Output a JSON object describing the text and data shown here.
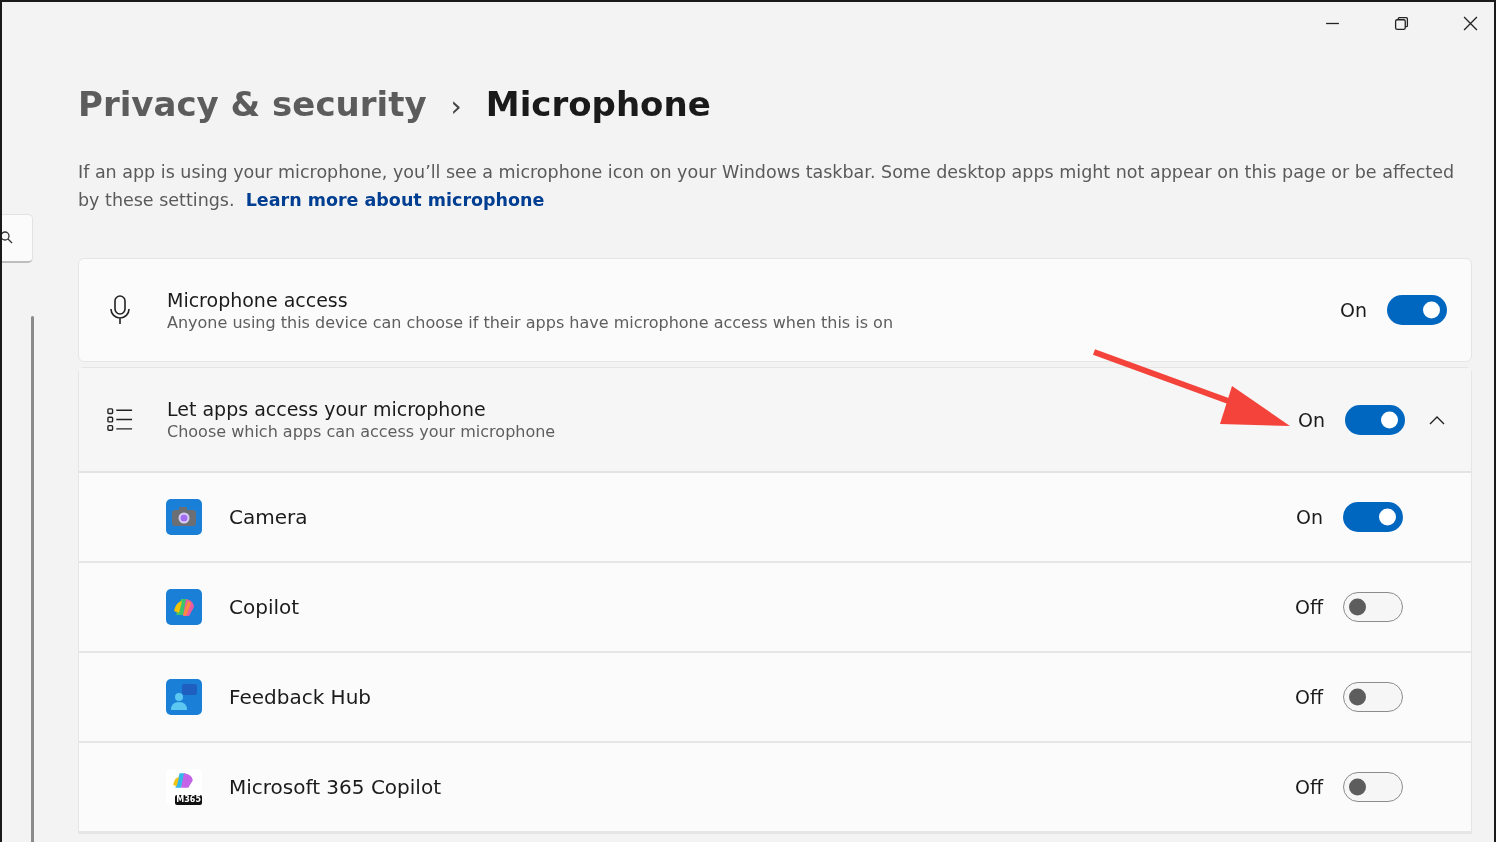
{
  "breadcrumb": {
    "parent": "Privacy & security",
    "separator": "›",
    "current": "Microphone"
  },
  "description": {
    "text": "If an app is using your microphone, you’ll see a microphone icon on your Windows taskbar. Some desktop apps might not appear on this page or be affected by these settings.",
    "link": "Learn more about microphone"
  },
  "microphone_access": {
    "title": "Microphone access",
    "subtitle": "Anyone using this device can choose if their apps have microphone access when this is on",
    "state_label": "On",
    "on": true
  },
  "let_apps": {
    "title": "Let apps access your microphone",
    "subtitle": "Choose which apps can access your microphone",
    "state_label": "On",
    "on": true,
    "expanded": true
  },
  "apps": [
    {
      "kind": "camera",
      "name": "Camera",
      "state_label": "On",
      "on": true
    },
    {
      "kind": "copilot",
      "name": "Copilot",
      "state_label": "Off",
      "on": false
    },
    {
      "kind": "feedback",
      "name": "Feedback Hub",
      "state_label": "Off",
      "on": false
    },
    {
      "kind": "m365",
      "name": "Microsoft 365 Copilot",
      "badge": "M365",
      "state_label": "Off",
      "on": false
    }
  ],
  "annotation": {
    "kind": "arrow"
  }
}
